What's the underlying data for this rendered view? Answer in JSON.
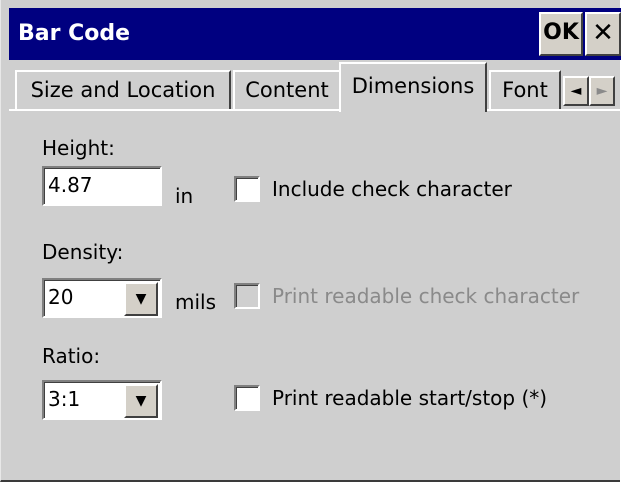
{
  "window": {
    "title": "Bar Code",
    "ok_label": "OK",
    "close_label": "✕"
  },
  "tabs": [
    {
      "label": "Size and Location"
    },
    {
      "label": "Content"
    },
    {
      "label": "Dimensions",
      "active": true
    },
    {
      "label": "Font"
    }
  ],
  "tab_scroll": {
    "left": "◄",
    "right": "►"
  },
  "height": {
    "label": "Height:",
    "value": "4.87",
    "unit": "in"
  },
  "density": {
    "label": "Density:",
    "value": "20",
    "unit": "mils"
  },
  "ratio": {
    "label": "Ratio:",
    "value": "3:1"
  },
  "dropdown_arrow": "▼",
  "checkboxes": {
    "include_check": {
      "label": "Include check character",
      "checked": false,
      "enabled": true
    },
    "print_readable_check": {
      "label": "Print readable check character",
      "checked": false,
      "enabled": false
    },
    "print_readable_startstop": {
      "label": "Print readable start/stop (*)",
      "checked": false,
      "enabled": true
    }
  },
  "colors": {
    "titlebar": "#000080",
    "dialog": "#cfcfcf",
    "disabled_text": "#8a8a8a"
  }
}
